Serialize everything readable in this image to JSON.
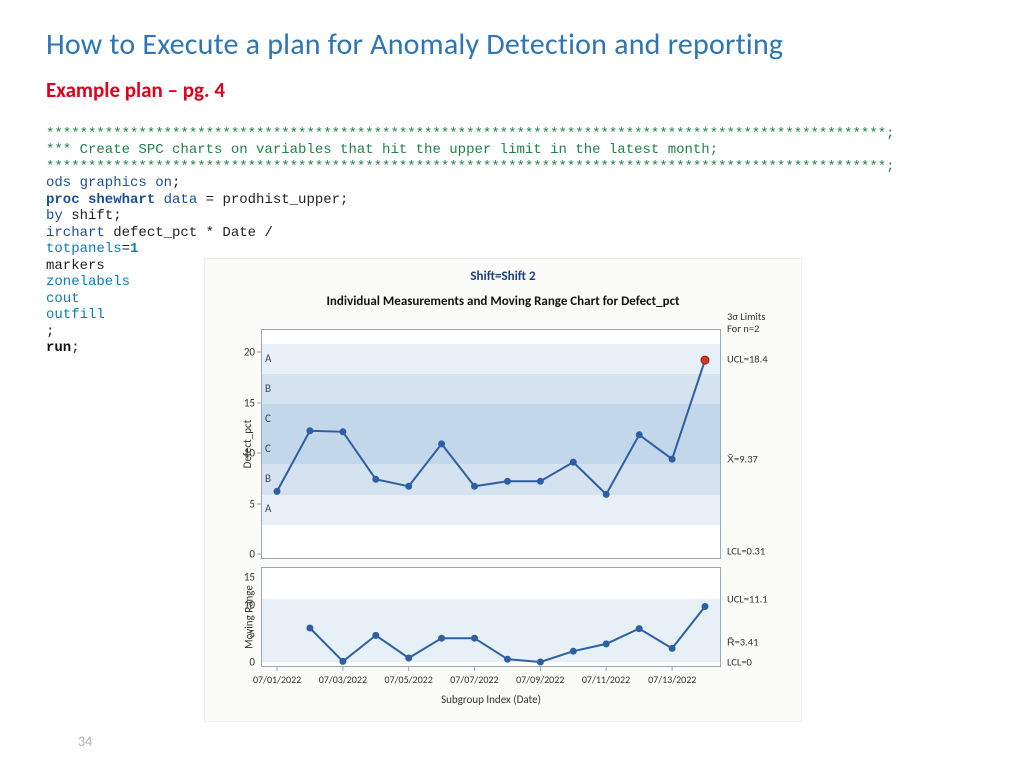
{
  "header": {
    "title": "How to Execute a plan for Anomaly Detection and reporting",
    "subtitle": "Example plan – pg. 4"
  },
  "code": {
    "sep1": "****************************************************************************************************;",
    "comment": "*** Create SPC charts on variables that hit the upper limit in the latest month;",
    "sep2": "****************************************************************************************************;",
    "l1a": "ods graphics on",
    "l1b": ";",
    "l2a": "proc shewhart",
    "l2b": " data",
    "l2c": " = prodhist_upper;",
    "l3a": "by",
    "l3b": " shift;",
    "l4a": "irchart",
    "l4b": " defect_pct * Date /",
    "l5a": "totpanels",
    "l5eq": "=",
    "l5b": "1",
    "l6": "markers",
    "l7": "zonelabels",
    "l8": "cout",
    "l9": "outfill",
    "l10": ";",
    "l11a": "run",
    "l11b": ";"
  },
  "chart": {
    "shift": "Shift=Shift 2",
    "title": "Individual Measurements and Moving Range Chart for Defect_pct",
    "sigma1": "3σ Limits",
    "sigma2": "For n=2",
    "ylabel1": "Defect_pct",
    "ylabel2": "Moving Range",
    "xlabel": "Subgroup Index (Date)",
    "zones": {
      "A": "A",
      "B": "B",
      "C": "C"
    },
    "top_limits": {
      "ucl": "UCL=18.4",
      "mean": "X̄=9.37",
      "lcl": "LCL=0.31"
    },
    "bot_limits": {
      "ucl": "UCL=11.1",
      "mean": "R̄=3.41",
      "lcl": "LCL=0"
    },
    "yticks_top": [
      "0",
      "5",
      "10",
      "15",
      "20"
    ],
    "yticks_bot": [
      "0",
      "5",
      "10",
      "15"
    ],
    "xticks": [
      "07/01/2022",
      "07/03/2022",
      "07/05/2022",
      "07/07/2022",
      "07/09/2022",
      "07/11/2022",
      "07/13/2022"
    ]
  },
  "footer": {
    "page": "34"
  },
  "chart_data": [
    {
      "type": "line",
      "title": "Individual Measurements and Moving Range Chart for Defect_pct",
      "subtitle": "Shift=Shift 2",
      "panel": "Individual (top)",
      "ylabel": "Defect_pct",
      "xlabel": "Subgroup Index (Date)",
      "categories": [
        "07/01/2022",
        "07/02/2022",
        "07/03/2022",
        "07/04/2022",
        "07/05/2022",
        "07/06/2022",
        "07/07/2022",
        "07/08/2022",
        "07/09/2022",
        "07/10/2022",
        "07/11/2022",
        "07/12/2022",
        "07/13/2022",
        "07/14/2022"
      ],
      "series": [
        {
          "name": "Defect_pct",
          "values": [
            6.2,
            12.2,
            12.1,
            7.4,
            6.7,
            10.9,
            6.7,
            7.2,
            7.2,
            9.1,
            5.9,
            11.8,
            9.4,
            19.2
          ]
        }
      ],
      "reference_lines": {
        "UCL": 18.4,
        "Mean": 9.37,
        "LCL": 0.31
      },
      "zone_labels": [
        "A",
        "B",
        "C",
        "C",
        "B",
        "A"
      ],
      "ylim": [
        0,
        20
      ],
      "outliers": [
        {
          "x": "07/14/2022",
          "y": 19.2
        }
      ]
    },
    {
      "type": "line",
      "panel": "Moving Range (bottom)",
      "ylabel": "Moving Range",
      "xlabel": "Subgroup Index (Date)",
      "categories": [
        "07/02/2022",
        "07/03/2022",
        "07/04/2022",
        "07/05/2022",
        "07/06/2022",
        "07/07/2022",
        "07/08/2022",
        "07/09/2022",
        "07/10/2022",
        "07/11/2022",
        "07/12/2022",
        "07/13/2022",
        "07/14/2022"
      ],
      "series": [
        {
          "name": "Moving Range",
          "values": [
            6.0,
            0.1,
            4.7,
            0.7,
            4.2,
            4.2,
            0.5,
            0.0,
            1.9,
            3.2,
            5.9,
            2.4,
            9.8
          ]
        }
      ],
      "reference_lines": {
        "UCL": 11.1,
        "Mean": 3.41,
        "LCL": 0
      },
      "ylim": [
        0,
        15
      ]
    }
  ]
}
